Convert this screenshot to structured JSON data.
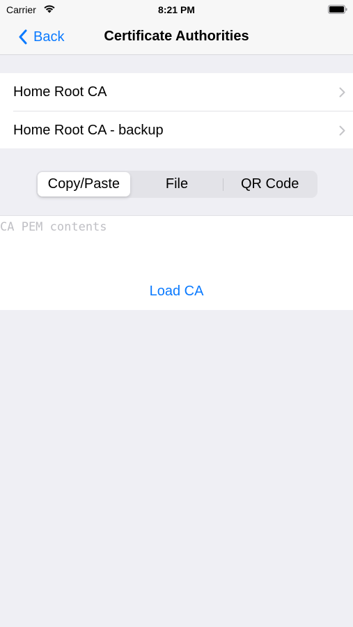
{
  "status_bar": {
    "carrier": "Carrier",
    "time": "8:21 PM",
    "wifi_icon": "wifi-icon",
    "battery_icon": "battery-icon"
  },
  "nav": {
    "back_label": "Back",
    "title": "Certificate Authorities",
    "accent_color": "#0a7aff"
  },
  "ca_list": {
    "items": [
      {
        "label": "Home Root CA"
      },
      {
        "label": "Home Root CA - backup"
      }
    ]
  },
  "segmented_control": {
    "segments": [
      "Copy/Paste",
      "File",
      "QR Code"
    ],
    "selected": "Copy/Paste"
  },
  "pem_input": {
    "placeholder": "CA PEM contents",
    "value": ""
  },
  "load_button": {
    "label": "Load CA"
  }
}
